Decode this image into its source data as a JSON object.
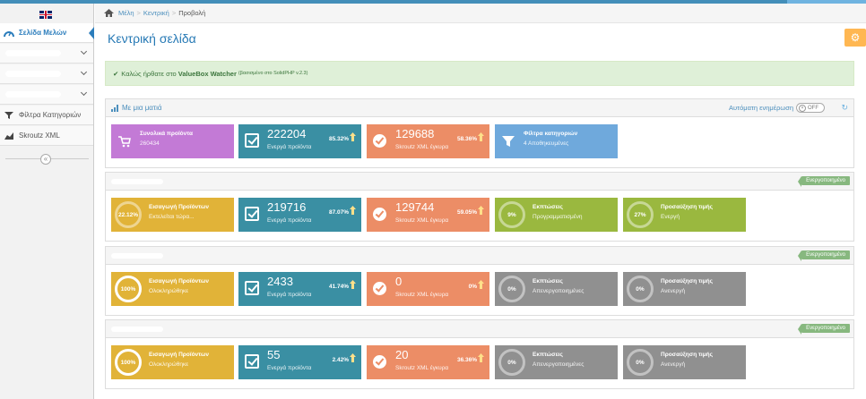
{
  "breadcrumb": {
    "items": [
      "Μέλη",
      "Κεντρική",
      "Προβολή"
    ]
  },
  "sidebar": {
    "items": [
      {
        "label": "Σελίδα Μελών",
        "icon": "tachometer-icon"
      },
      {
        "label": "",
        "icon": ""
      },
      {
        "label": "",
        "icon": ""
      },
      {
        "label": "",
        "icon": ""
      },
      {
        "label": "Φίλτρα Κατηγοριών",
        "icon": "filter-icon"
      },
      {
        "label": "Skroutz XML",
        "icon": "chart-icon"
      }
    ]
  },
  "page_title": "Κεντρική σελίδα",
  "alert": {
    "prefix": "Καλώς ήρθατε στο",
    "brand": "ValueBox Watcher",
    "small": "(βασισμένο στο SolidPHP v.2.3)"
  },
  "overview": {
    "title": "Με μια ματιά",
    "autoupdate_label": "Αυτόματη ενημέρωση",
    "toggle_label": "OFF",
    "tiles": {
      "total_title": "Συνολικά προϊόντα",
      "total_value": "260434",
      "active_value": "222204",
      "active_label": "Ενεργά προϊόντα",
      "active_pct": "85.32%",
      "xml_value": "129688",
      "xml_label": "Skroutz XML έγκυρα",
      "xml_pct": "58.36%",
      "filters_title": "Φίλτρα κατηγοριών",
      "filters_sub": "4 Αποθηκευμένες"
    }
  },
  "shops": [
    {
      "badge": "Ενεργοποιημένο",
      "import_pct": "22.12%",
      "import_title": "Εισαγωγή Προϊόντων",
      "import_sub": "Εκτελείται τώρα...",
      "active_value": "219716",
      "active_label": "Ενεργά προϊόντα",
      "active_pct": "87.07%",
      "xml_value": "129744",
      "xml_label": "Skroutz XML έγκυρα",
      "xml_pct": "59.05%",
      "disc_pct": "9%",
      "disc_title": "Εκπτώσεις",
      "disc_sub": "Προγραμματισμένη",
      "price_pct": "27%",
      "price_title": "Προσαύξηση τιμής",
      "price_sub": "Ενεργή"
    },
    {
      "badge": "Ενεργοποιημένο",
      "import_pct": "100%",
      "import_title": "Εισαγωγή Προϊόντων",
      "import_sub": "Ολοκληρώθηκε",
      "active_value": "2433",
      "active_label": "Ενεργά προϊόντα",
      "active_pct": "41.74%",
      "xml_value": "0",
      "xml_label": "Skroutz XML έγκυρα",
      "xml_pct": "0%",
      "disc_pct": "0%",
      "disc_title": "Εκπτώσεις",
      "disc_sub": "Απενεργοποιημένες",
      "price_pct": "0%",
      "price_title": "Προσαύξηση τιμής",
      "price_sub": "Ανενεργή"
    },
    {
      "badge": "Ενεργοποιημένο",
      "import_pct": "100%",
      "import_title": "Εισαγωγή Προϊόντων",
      "import_sub": "Ολοκληρώθηκε",
      "active_value": "55",
      "active_label": "Ενεργά προϊόντα",
      "active_pct": "2.42%",
      "xml_value": "20",
      "xml_label": "Skroutz XML έγκυρα",
      "xml_pct": "36.36%",
      "disc_pct": "0%",
      "disc_title": "Εκπτώσεις",
      "disc_sub": "Απενεργοποιημένες",
      "price_pct": "0%",
      "price_title": "Προσαύξηση τιμής",
      "price_sub": "Ανενεργή"
    }
  ],
  "colors": {
    "accent": "#438eb9",
    "purple": "#c37ad6",
    "teal": "#3a8fa3",
    "orange": "#ec8d66",
    "lightblue": "#6fa9dc",
    "yellow": "#e1b338",
    "green": "#9ab83f",
    "gray": "#909090"
  }
}
